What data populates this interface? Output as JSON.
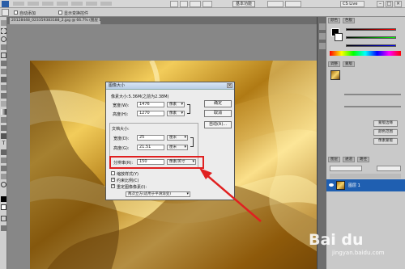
{
  "menubar": {
    "essential": "基本功能",
    "cs_live": "CS Live",
    "window_controls": [
      "–",
      "□",
      "×"
    ]
  },
  "options": {
    "resize_label": "自动添加",
    "tool_hint": "显示变换控件"
  },
  "document_tab": {
    "label": "20128448_023359383188_2.jpg @ 66.7% (图层 1, RGB/8#)"
  },
  "dialog": {
    "title": "图像大小",
    "pixel_dimensions": "像素大小:5.36M(之前为2.38M)",
    "width_label": "宽度(W):",
    "width_value": "1476",
    "height_label": "高度(H):",
    "height_value": "1270",
    "pixel_unit": "像素",
    "doc_size_label": "文档大小:",
    "doc_width_label": "宽度(D):",
    "doc_width_value": "25",
    "doc_height_label": "高度(G):",
    "doc_height_value": "21.51",
    "cm_unit": "厘米",
    "resolution_label": "分辨率(R):",
    "resolution_value": "150",
    "resolution_unit": "像素/英寸",
    "scale_styles": "缩放样式(Y)",
    "constrain": "约束比例(C)",
    "resample": "重定图像像素(I):",
    "resample_method": "两次立方(适用于平滑渐变)",
    "ok": "确定",
    "cancel": "取消",
    "auto": "自动(A)..."
  },
  "panels": {
    "color_tab": "颜色",
    "swatches_tab": "色板",
    "adjust_tab": "调整",
    "masks_tab": "蒙版",
    "layers_tab": "图层",
    "channels_tab": "通道",
    "paths_tab": "路径",
    "layer_name": "图层 1",
    "btn_a": "像素蒙版",
    "btn_b": "颜色范围",
    "btn_c": "蒙版边缘"
  },
  "colors": {
    "highlight": "#e02020",
    "arrow": "#e02020",
    "layer_selected": "#1f5fb1"
  },
  "watermark": {
    "brand": "Bai du",
    "sub": "jingyan.baidu.com"
  }
}
